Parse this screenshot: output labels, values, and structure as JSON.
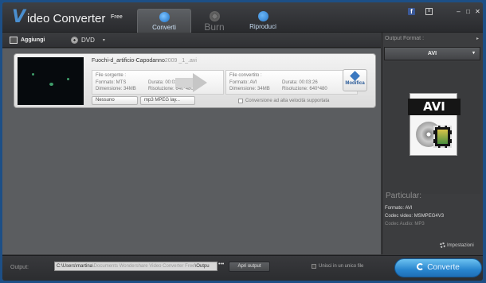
{
  "app": {
    "logo_letter": "V",
    "title": "ideo Converter",
    "edition": "Free"
  },
  "tabs": [
    {
      "label": "Converti"
    },
    {
      "label": "Burn"
    },
    {
      "label": "Riproduci"
    }
  ],
  "window_controls": {
    "facebook": "f",
    "register": "≡",
    "minimize": "–",
    "maximize": "□",
    "close": "✕"
  },
  "toolbar": {
    "add_label": "Aggiungi",
    "dvd_label": "DVD",
    "dropdown": "▾"
  },
  "file": {
    "name_main": "Fuochi-d_artificio-Capodanno",
    "name_dim": "2009 _1_.avi",
    "source": {
      "title": "File sorgente :",
      "format": "Formato: MTS",
      "size": "Dimensione: 34MB",
      "duration": "Durata: 00:03:26",
      "resolution": "Risoluzione: 640*480"
    },
    "converted": {
      "title": "File convertito :",
      "format": "Formato: AVI",
      "size": "Dimensione: 34MB",
      "duration": "Durata: 00:03:26",
      "resolution": "Risoluzione: 640*480"
    },
    "edit_label": "Modifica",
    "subtitle_select": "Nessuno",
    "audio_select": "mp3 MPEG lay...",
    "hi_speed_label": "Conversione ad alta velocità supportata"
  },
  "right_panel": {
    "header": "Output Format :",
    "header_arrow": "▸",
    "format_value": "AVI",
    "doc_label": "AVI",
    "particular_title": "Particular:",
    "details": [
      "Formato: AVI",
      "Codec video: MSMPEG4V3",
      "Codec Audio: MP3"
    ],
    "settings_label": "Impostazioni"
  },
  "bottom": {
    "output_label": "Output:",
    "output_path_main": "C:\\Users\\martina",
    "output_path_dim": "\\Documents Wondershare Video Converter Free",
    "output_path_tail": "\\Outpu",
    "dots": "•••",
    "open_output": "Apri output",
    "merge_label": "Unisci in un unico file",
    "convert_label": "Converte"
  },
  "colors": {
    "accent": "#2986cf",
    "window_bg": "#3a3b3d",
    "list_bg": "#5b5d60"
  }
}
